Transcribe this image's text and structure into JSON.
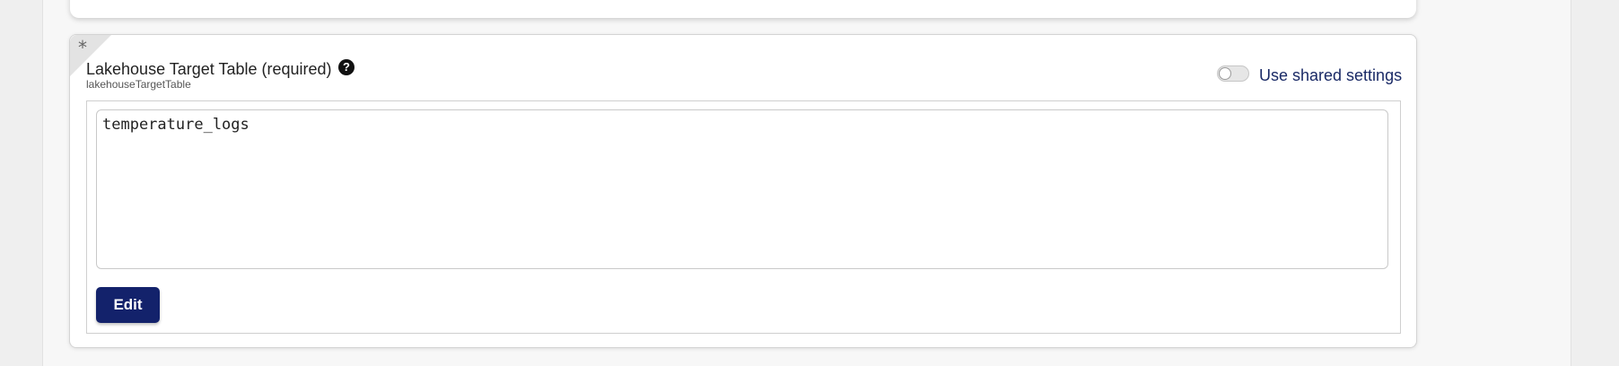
{
  "field": {
    "title": "Lakehouse Target Table (required)",
    "key": "lakehouseTargetTable",
    "required_marker": "*",
    "help_icon_glyph": "?",
    "value": "temperature_logs",
    "edit_label": "Edit",
    "shared_settings_label": "Use shared settings",
    "shared_settings_enabled": false
  },
  "colors": {
    "primary_button": "#13226b",
    "link_text": "#1a2a66",
    "page_background": "#efefef"
  },
  "icons": {
    "help": "question-circle-icon",
    "required": "asterisk-icon"
  }
}
